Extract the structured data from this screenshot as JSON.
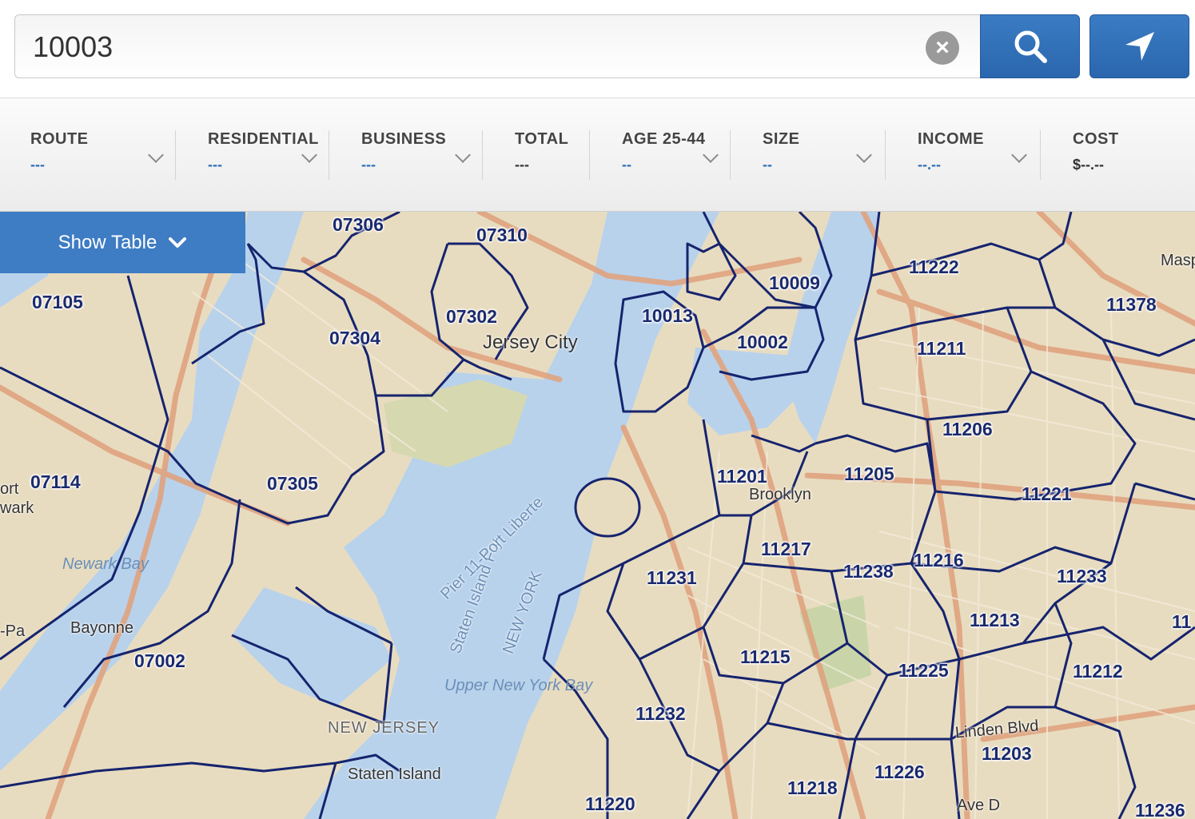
{
  "search": {
    "value": "10003",
    "clear_symbol": "×"
  },
  "stats": {
    "route": {
      "label": "ROUTE",
      "value": "---"
    },
    "residential": {
      "label": "RESIDENTIAL",
      "value": "---"
    },
    "business": {
      "label": "BUSINESS",
      "value": "---"
    },
    "total": {
      "label": "TOTAL",
      "value": "---"
    },
    "age": {
      "label": "AGE 25-44",
      "value": "--"
    },
    "size": {
      "label": "SIZE",
      "value": "--"
    },
    "income": {
      "label": "INCOME",
      "value": "--.--"
    },
    "cost": {
      "label": "COST",
      "value": "$--.--"
    }
  },
  "show_table": {
    "label": "Show Table"
  },
  "map": {
    "zip_codes": [
      "07306",
      "07310",
      "07105",
      "07302",
      "07304",
      "07114",
      "07305",
      "07002",
      "10009",
      "10013",
      "10002",
      "11222",
      "11378",
      "11211",
      "11206",
      "11205",
      "11201",
      "11221",
      "11217",
      "11238",
      "11216",
      "11233",
      "11231",
      "11213",
      "11215",
      "11225",
      "11212",
      "11232",
      "11203",
      "11226",
      "11218",
      "11220",
      "11236",
      "11"
    ],
    "places": [
      "Jersey City",
      "Brooklyn",
      "Bayonne",
      "Staten Island",
      "Newark Bay",
      "Upper New York Bay",
      "NEW JERSEY",
      "NEW YORK",
      "Staten Island Fry",
      "Pier 11-Port Liberte",
      "Linden Blvd",
      "Ave D",
      "Masp",
      "ort",
      "wark",
      "-Pa"
    ]
  },
  "colors": {
    "accent": "#3e7cc4",
    "water": "#b8d2ec",
    "land": "#e8dcc0",
    "boundary": "#16246e",
    "road": "#e0a37f"
  }
}
